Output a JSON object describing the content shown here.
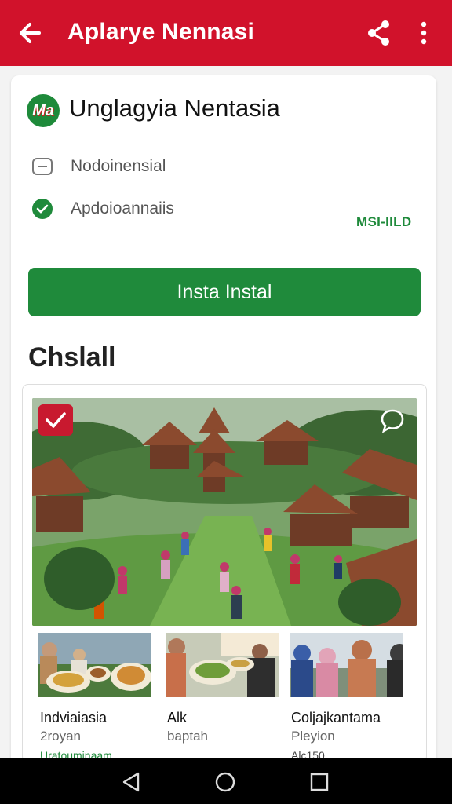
{
  "topbar": {
    "title": "Aplarye Nennasi",
    "back_icon": "arrow-left-icon",
    "share_icon": "share-icon",
    "more_icon": "more-vert-icon",
    "color": "#d1122b"
  },
  "app": {
    "logo_text": "Ma",
    "title": "Unglagyia Nentasia",
    "rows": [
      {
        "icon": "text-icon",
        "label": "Nodoinensial"
      },
      {
        "icon": "check-circle-icon",
        "label": "Apdoioannaiis"
      }
    ],
    "badge": "MSI-IILD",
    "install_label": "Insta Instal",
    "accent": "#1f8a3b"
  },
  "section": {
    "title": "Chslall"
  },
  "gallery": {
    "hero_check_icon": "check-icon",
    "hero_chat_icon": "chat-bubble-icon",
    "items": [
      {
        "name": "Indviaiasia",
        "sub": "2royan",
        "extra": "Uratouminaam"
      },
      {
        "name": "Alk",
        "sub": "baptah",
        "extra": ""
      },
      {
        "name": "Coljajkantama",
        "sub": "Pleyion",
        "extra": "Alc150"
      }
    ]
  },
  "navbar": {
    "back_icon": "nav-back-icon",
    "home_icon": "nav-home-icon",
    "recents_icon": "nav-recents-icon"
  }
}
